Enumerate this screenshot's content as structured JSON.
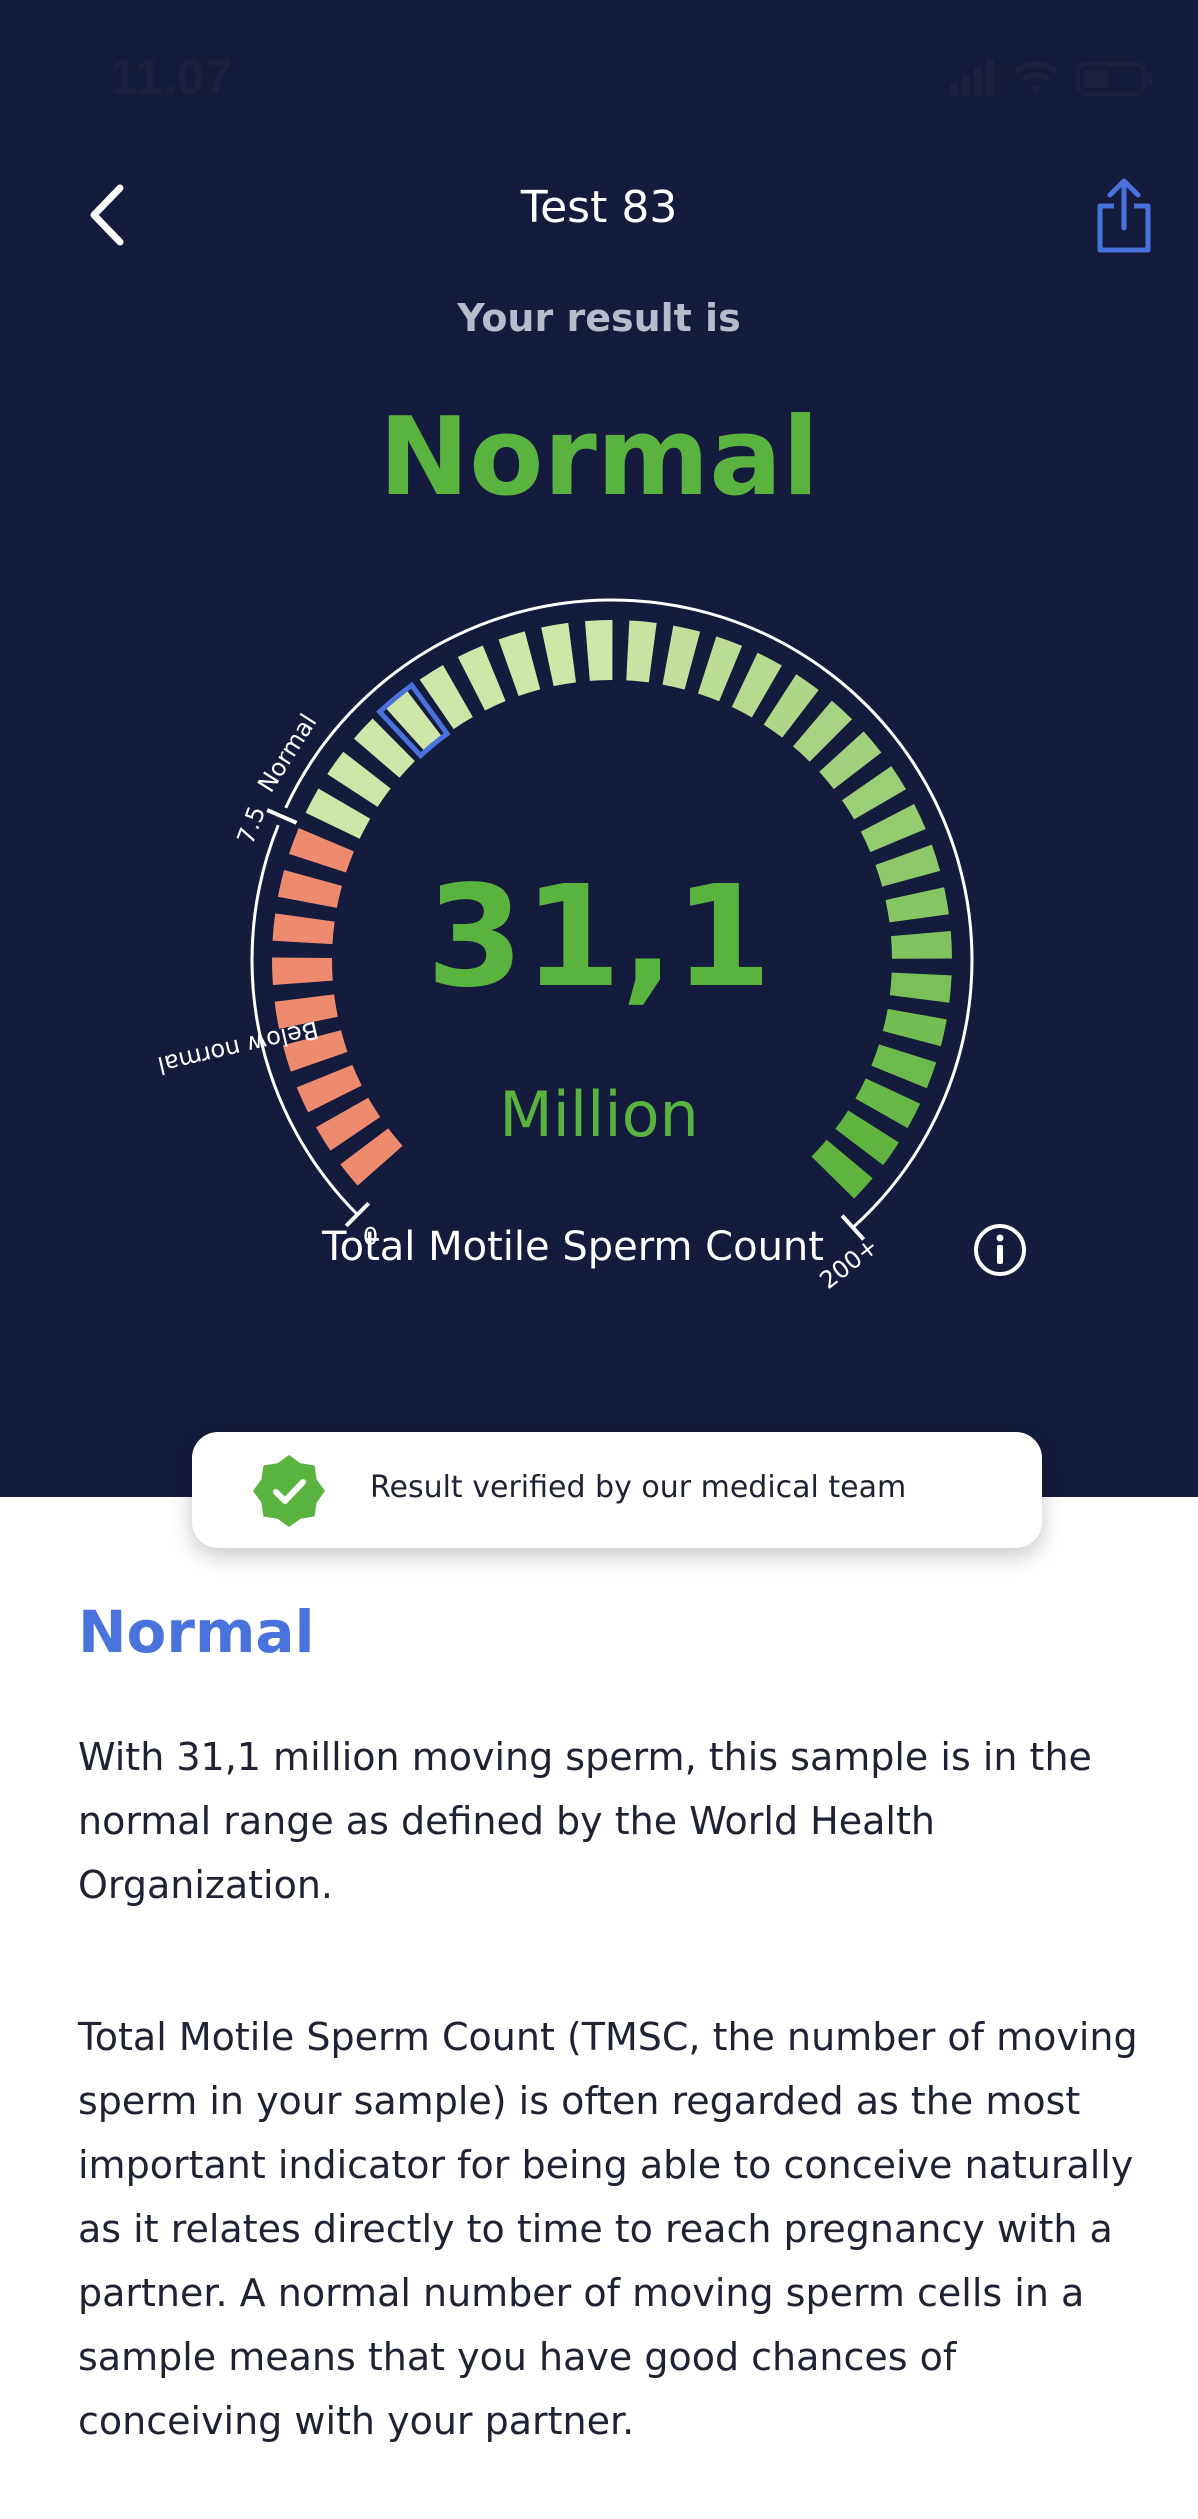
{
  "status_bar": {
    "time": "11.07"
  },
  "nav": {
    "title": "Test 83",
    "back_icon": "chevron-left-icon",
    "share_icon": "share-icon"
  },
  "result": {
    "intro": "Your result is",
    "label": "Normal"
  },
  "gauge": {
    "value": "31,1",
    "value_numeric": 31.1,
    "unit": "Million",
    "metric_label": "Total Motile Sperm Count",
    "labels": {
      "min": "0",
      "threshold": "7.5",
      "max": "200+",
      "below_zone": "Below normal",
      "normal_zone": "Normal"
    },
    "threshold_value": 7.5,
    "colors": {
      "below": "#ee8b6e",
      "normal_light": "#cfe6a8",
      "normal_dark": "#5fb43f",
      "marker": "#4a72dd"
    }
  },
  "verification": {
    "text": "Result verified by our medical team",
    "icon": "verified-badge-icon",
    "color": "#5ab33e"
  },
  "details": {
    "title": "Normal",
    "paragraph1": "With 31,1 million moving sperm, this sample is in the normal range as defined by the World Health Organization.",
    "paragraph2": "Total Motile Sperm Count (TMSC, the number of moving sperm in your sample) is often regarded as the most important indicator for being able to conceive naturally as it relates directly to time to reach pregnancy with a partner. A normal number of moving sperm cells in a sample means that you have good chances of conceiving with your partner."
  },
  "colors": {
    "header_bg": "#151b3c",
    "accent_blue": "#4a72dd",
    "accent_green": "#5ab33e"
  }
}
